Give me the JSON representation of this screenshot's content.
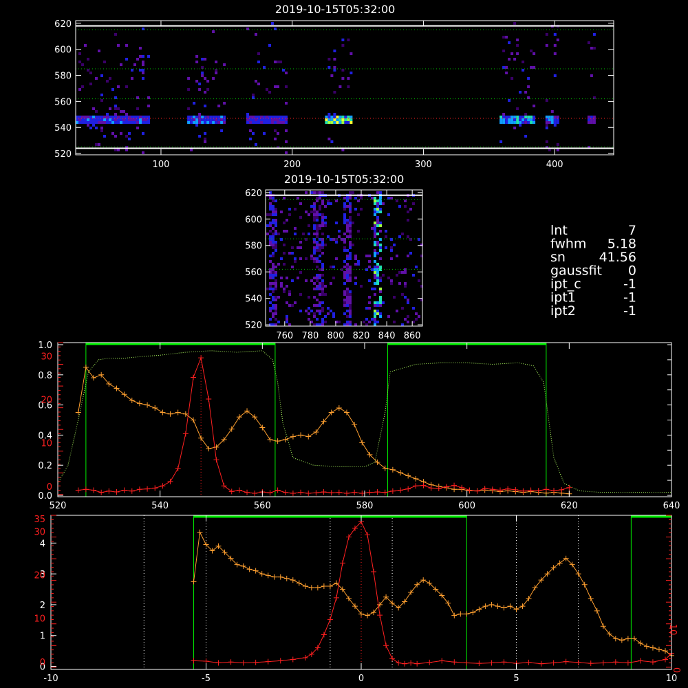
{
  "colors": {
    "orange": "#ffa030",
    "red": "#ff2020",
    "green": "#00ee00",
    "green_dotted": "#b0ff60",
    "white": "#ffffff"
  },
  "info_panel": [
    {
      "key": "lnt",
      "label": "lnt",
      "value": "7"
    },
    {
      "key": "fwhm",
      "label": "fwhm",
      "value": "5.18"
    },
    {
      "key": "sn",
      "label": "sn",
      "value": "41.56"
    },
    {
      "key": "gaussfit",
      "label": "gaussfit",
      "value": "0"
    },
    {
      "key": "ipt_c",
      "label": "ipt_c",
      "value": "-1"
    },
    {
      "key": "ipt1",
      "label": "ipt1",
      "value": "-1"
    },
    {
      "key": "ipt2",
      "label": "ipt2",
      "value": "-1"
    }
  ],
  "chart_data": [
    {
      "id": "dynamic-spectrum",
      "type": "heatmap",
      "title": "2019-10-15T05:32:00",
      "xlim": [
        35,
        445
      ],
      "ylim": [
        519,
        622
      ],
      "x_ticks": [
        "100",
        "200",
        "300",
        "400"
      ],
      "y_ticks": [
        "520",
        "540",
        "560",
        "580",
        "600",
        "620"
      ],
      "x_tick_values": [
        100,
        200,
        300,
        400
      ],
      "y_tick_values": [
        520,
        540,
        560,
        580,
        600,
        620
      ],
      "hlines_dotted_green": [
        615,
        585,
        562,
        525
      ],
      "hline_dotted_red": 547,
      "hlines_white": [
        618,
        524
      ],
      "bright_row": 547,
      "segments": [
        {
          "x0": 35,
          "x1": 90,
          "peak": 0.55
        },
        {
          "x0": 120,
          "x1": 148,
          "peak": 0.6
        },
        {
          "x0": 165,
          "x1": 195,
          "peak": 0.5
        },
        {
          "x0": 225,
          "x1": 245,
          "peak": 1.0
        },
        {
          "x0": 358,
          "x1": 385,
          "peak": 0.75
        },
        {
          "x0": 393,
          "x1": 403,
          "peak": 0.6
        },
        {
          "x0": 425,
          "x1": 430,
          "peak": 0.5
        }
      ]
    },
    {
      "id": "zoom-spectrum",
      "type": "heatmap",
      "title": "2019-10-15T05:32:00",
      "xlim": [
        745,
        868
      ],
      "ylim": [
        519,
        622
      ],
      "x_ticks": [
        "760",
        "780",
        "800",
        "820",
        "840",
        "860"
      ],
      "y_ticks": [
        "520",
        "540",
        "560",
        "580",
        "600",
        "620"
      ],
      "x_tick_values": [
        760,
        780,
        800,
        820,
        840,
        860
      ],
      "y_tick_values": [
        520,
        540,
        560,
        580,
        600,
        620
      ],
      "hlines_dotted_green": [
        615,
        585,
        562
      ],
      "hlines_white": [
        618
      ],
      "columns": [
        {
          "x": 750,
          "peak": 0.5
        },
        {
          "x": 785,
          "peak": 0.45
        },
        {
          "x": 808,
          "peak": 0.5
        },
        {
          "x": 832,
          "peak": 0.9
        }
      ]
    },
    {
      "id": "profile-frequency",
      "type": "line",
      "xlim": [
        520,
        640
      ],
      "x_ticks": [
        "520",
        "540",
        "560",
        "580",
        "600",
        "620",
        "640"
      ],
      "x_tick_values": [
        520,
        540,
        560,
        580,
        600,
        620,
        640
      ],
      "y_left_white_ticks": [
        "0.0",
        "0.2",
        "0.4",
        "0.6",
        "0.8",
        "1.0"
      ],
      "y_left_white_values": [
        0,
        0.2,
        0.4,
        0.6,
        0.8,
        1.0
      ],
      "y_left_red_ticks": [
        "0",
        "10",
        "20",
        "30"
      ],
      "y_left_red_values": [
        0,
        10,
        20,
        30
      ],
      "ylim_red": [
        -0.5,
        35
      ],
      "ylim_white": [
        0,
        1.0
      ],
      "green_windows": [
        [
          525.5,
          562.5
        ],
        [
          584.5,
          615.5
        ]
      ],
      "vline_red": 548,
      "series": [
        {
          "color": "orange",
          "x": [
            524,
            525.5,
            527,
            528.5,
            530,
            531.5,
            533,
            534.5,
            536,
            537.5,
            539,
            540.5,
            542,
            543.5,
            545,
            546.5,
            548,
            549.5,
            551,
            552.5,
            554,
            555.5,
            557,
            558.5,
            560,
            561.5,
            563,
            564.5,
            566,
            567.5,
            569,
            570.5,
            572,
            573.5,
            575,
            576.5,
            578,
            579.5,
            581,
            582.5,
            584,
            585.5,
            587,
            588.5,
            590,
            591.5,
            593,
            594.5,
            596,
            597.5,
            599,
            600.5,
            602,
            603.5,
            605,
            606.5,
            608,
            609.5,
            611,
            612.5,
            614,
            615.5,
            617,
            618.5,
            620
          ],
          "y": [
            0.55,
            0.85,
            0.78,
            0.8,
            0.74,
            0.71,
            0.67,
            0.63,
            0.61,
            0.6,
            0.58,
            0.55,
            0.54,
            0.55,
            0.54,
            0.5,
            0.38,
            0.31,
            0.32,
            0.37,
            0.44,
            0.52,
            0.56,
            0.52,
            0.45,
            0.37,
            0.36,
            0.37,
            0.39,
            0.4,
            0.39,
            0.42,
            0.49,
            0.55,
            0.58,
            0.55,
            0.47,
            0.35,
            0.27,
            0.22,
            0.18,
            0.17,
            0.15,
            0.13,
            0.11,
            0.09,
            0.07,
            0.06,
            0.05,
            0.04,
            0.04,
            0.03,
            0.03,
            0.035,
            0.03,
            0.025,
            0.03,
            0.025,
            0.02,
            0.025,
            0.02,
            0.015,
            0.02,
            0.015,
            0.01
          ]
        },
        {
          "color": "red",
          "x": [
            524,
            525.5,
            527,
            528.5,
            530,
            531.5,
            533,
            534.5,
            536,
            537.5,
            539,
            540.5,
            542,
            543.5,
            545,
            546.5,
            548,
            549.5,
            551,
            552.5,
            554,
            555.5,
            557,
            558.5,
            560,
            561.5,
            563,
            564.5,
            566,
            567.5,
            569,
            570.5,
            572,
            573.5,
            575,
            576.5,
            578,
            579.5,
            581,
            582.5,
            584,
            585.5,
            587,
            588.5,
            590,
            591.5,
            593,
            594.5,
            596,
            597.5,
            599,
            600.5,
            602,
            603.5,
            605,
            606.5,
            608,
            609.5,
            611,
            612.5,
            614,
            615.5,
            617,
            618.5,
            620
          ],
          "y": [
            1.0,
            1.2,
            1.0,
            0.5,
            0.8,
            0.6,
            1.0,
            0.8,
            1.2,
            1.3,
            1.5,
            2.0,
            3.0,
            6.0,
            14.0,
            27.0,
            31.5,
            22.0,
            8.0,
            2.0,
            0.7,
            1.0,
            0.5,
            0.3,
            0.6,
            0.4,
            1.0,
            0.5,
            0.3,
            0.5,
            0.3,
            0.4,
            0.6,
            0.4,
            0.5,
            0.3,
            0.5,
            0.3,
            0.5,
            0.6,
            0.5,
            0.8,
            1.0,
            1.3,
            2.0,
            2.1,
            1.5,
            1.4,
            1.8,
            2.1,
            1.6,
            1.0,
            0.8,
            1.4,
            1.2,
            1.0,
            1.3,
            1.1,
            0.8,
            1.0,
            0.9,
            1.2,
            0.9,
            1.1,
            1.6
          ]
        },
        {
          "color": "green_dotted",
          "x": [
            520,
            522,
            524,
            526,
            528,
            530,
            533,
            536,
            540,
            545,
            550,
            555,
            560,
            562,
            563,
            564,
            566,
            570,
            575,
            580,
            582,
            584,
            585,
            590,
            595,
            600,
            605,
            610,
            613,
            615,
            616,
            617,
            619,
            622,
            626,
            630,
            635,
            640
          ],
          "y": [
            0.08,
            0.2,
            0.5,
            0.82,
            0.9,
            0.91,
            0.91,
            0.92,
            0.93,
            0.95,
            0.96,
            0.95,
            0.96,
            0.9,
            0.75,
            0.48,
            0.25,
            0.2,
            0.19,
            0.19,
            0.22,
            0.55,
            0.82,
            0.87,
            0.88,
            0.88,
            0.87,
            0.88,
            0.86,
            0.75,
            0.5,
            0.25,
            0.08,
            0.03,
            0.02,
            0.02,
            0.02,
            0.02
          ]
        }
      ]
    },
    {
      "id": "profile-velocity",
      "type": "line",
      "xlim": [
        -10,
        10
      ],
      "x_ticks": [
        "-10",
        "-5",
        "0",
        "5",
        "10"
      ],
      "x_tick_values": [
        -10,
        -5,
        0,
        5,
        10
      ],
      "y_left_white_ticks": [
        "0",
        "1",
        "2",
        "3",
        "4"
      ],
      "y_left_white_values": [
        0,
        1,
        2,
        3,
        4
      ],
      "y_left_red_ticks": [
        "0",
        "10",
        "20",
        "30"
      ],
      "y_left_red_values": [
        0,
        10,
        20,
        30
      ],
      "y_left_extra": "35",
      "y_right_red_ticks": [
        "0",
        "10"
      ],
      "y_right_red_values": [
        0,
        10
      ],
      "ylim_white": [
        -0.1,
        4.9
      ],
      "ylim_red": [
        -0.5,
        35
      ],
      "green_windows": [
        [
          -5.4,
          3.4
        ],
        [
          8.7,
          10
        ]
      ],
      "vlines_dotted_white": [
        -7,
        -5,
        -1,
        1,
        5,
        7
      ],
      "vline_red": 0,
      "series": [
        {
          "color": "orange",
          "x": [
            -5.4,
            -5.2,
            -5.0,
            -4.8,
            -4.6,
            -4.4,
            -4.2,
            -4.0,
            -3.8,
            -3.6,
            -3.4,
            -3.2,
            -3.0,
            -2.8,
            -2.6,
            -2.4,
            -2.2,
            -2.0,
            -1.8,
            -1.6,
            -1.4,
            -1.2,
            -1.0,
            -0.8,
            -0.6,
            -0.4,
            -0.2,
            0.0,
            0.2,
            0.4,
            0.6,
            0.8,
            1.0,
            1.2,
            1.4,
            1.6,
            1.8,
            2.0,
            2.2,
            2.4,
            2.6,
            2.8,
            3.0,
            3.2,
            3.4,
            3.6,
            3.8,
            4.0,
            4.2,
            4.4,
            4.6,
            4.8,
            5.0,
            5.2,
            5.4,
            5.6,
            5.8,
            6.0,
            6.2,
            6.4,
            6.6,
            6.8,
            7.0,
            7.2,
            7.4,
            7.6,
            7.8,
            8.0,
            8.2,
            8.4,
            8.6,
            8.8,
            9.0,
            9.2,
            9.4,
            9.6,
            9.8,
            10.0
          ],
          "y": [
            2.75,
            4.35,
            3.95,
            3.75,
            3.9,
            3.7,
            3.5,
            3.3,
            3.25,
            3.15,
            3.1,
            3.0,
            2.95,
            2.9,
            2.9,
            2.85,
            2.8,
            2.7,
            2.6,
            2.55,
            2.55,
            2.6,
            2.6,
            2.7,
            2.5,
            2.2,
            1.95,
            1.7,
            1.65,
            1.75,
            2.0,
            2.25,
            2.05,
            1.9,
            2.1,
            2.4,
            2.65,
            2.8,
            2.7,
            2.5,
            2.3,
            2.05,
            1.65,
            1.7,
            1.7,
            1.75,
            1.85,
            1.95,
            2.0,
            1.95,
            1.9,
            1.95,
            1.85,
            1.95,
            2.2,
            2.55,
            2.8,
            3.0,
            3.2,
            3.35,
            3.5,
            3.3,
            3.0,
            2.65,
            2.2,
            1.8,
            1.3,
            1.05,
            0.9,
            0.85,
            0.9,
            0.9,
            0.75,
            0.65,
            0.6,
            0.55,
            0.5,
            0.35
          ]
        },
        {
          "color": "red",
          "x": [
            -5.4,
            -5.0,
            -4.6,
            -4.2,
            -3.8,
            -3.4,
            -3.0,
            -2.6,
            -2.2,
            -1.8,
            -1.6,
            -1.4,
            -1.2,
            -1.0,
            -0.8,
            -0.6,
            -0.4,
            -0.2,
            0.0,
            0.2,
            0.4,
            0.6,
            0.8,
            1.0,
            1.2,
            1.4,
            1.6,
            1.8,
            2.2,
            2.6,
            3.0,
            3.4,
            3.8,
            4.2,
            4.6,
            5.0,
            5.4,
            5.8,
            6.2,
            6.6,
            7.0,
            7.4,
            7.8,
            8.2,
            8.6,
            9.0,
            9.4,
            9.8,
            10.0
          ],
          "y": [
            1.5,
            1.4,
            1.0,
            1.2,
            1.0,
            1.1,
            1.3,
            1.5,
            1.8,
            2.2,
            3.0,
            4.5,
            7.5,
            11.0,
            16.0,
            24.0,
            30.0,
            32.0,
            33.5,
            30.5,
            22.0,
            12.0,
            5.0,
            2.0,
            1.0,
            0.8,
            1.0,
            0.8,
            1.1,
            1.5,
            1.2,
            1.0,
            0.9,
            1.0,
            1.2,
            0.9,
            1.1,
            0.8,
            1.0,
            1.3,
            1.1,
            0.9,
            1.0,
            1.2,
            1.0,
            1.5,
            1.2,
            1.8,
            3.2
          ]
        }
      ]
    }
  ]
}
